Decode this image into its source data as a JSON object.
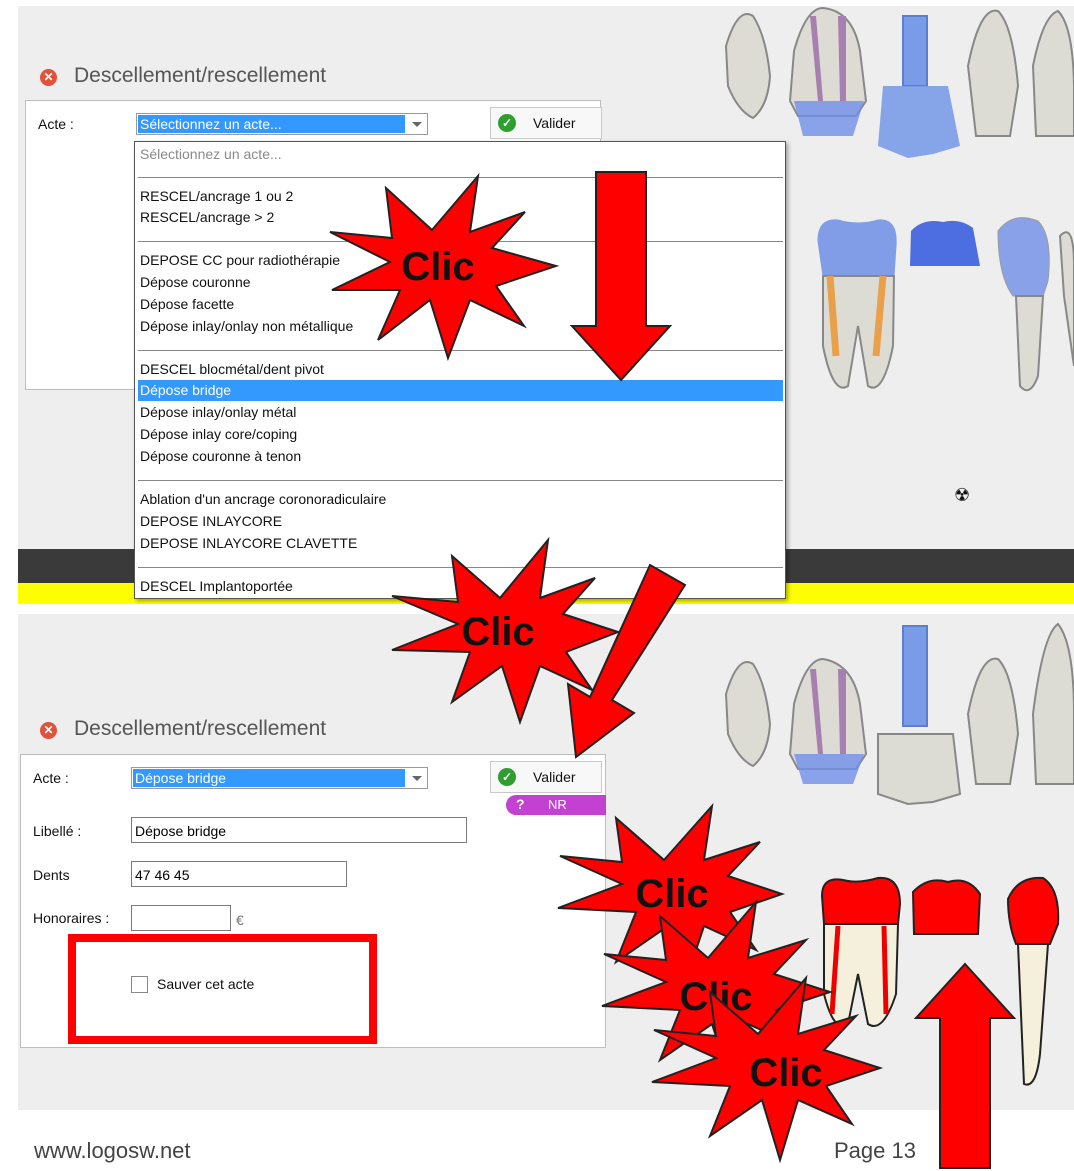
{
  "top_dialog": {
    "title": "Descellement/rescellement",
    "acte_label": "Acte :",
    "acte_value": "Sélectionnez un acte...",
    "valider_label": "Valider",
    "dropdown": {
      "placeholder": "Sélectionnez un acte...",
      "groups": [
        [
          "RESCEL/ancrage 1 ou 2",
          "RESCEL/ancrage > 2"
        ],
        [
          "DEPOSE CC pour radiothérapie",
          "Dépose couronne",
          "Dépose facette",
          "Dépose inlay/onlay non métallique"
        ],
        [
          "DESCEL blocmétal/dent pivot",
          "Dépose bridge",
          "Dépose inlay/onlay métal",
          "Dépose inlay core/coping",
          "Dépose couronne à tenon"
        ],
        [
          "Ablation d'un ancrage coronoradiculaire",
          "DEPOSE INLAYCORE",
          "DEPOSE INLAYCORE CLAVETTE"
        ],
        [
          "DESCEL Implantoportée"
        ]
      ],
      "highlighted": "Dépose bridge"
    }
  },
  "bottom_dialog": {
    "title": "Descellement/rescellement",
    "acte_label": "Acte :",
    "acte_value": "Dépose bridge",
    "valider_label": "Valider",
    "nr_badge": "NR",
    "libelle_label": "Libellé :",
    "libelle_value": "Dépose bridge",
    "dents_label": "Dents",
    "dents_value": "47 46 45",
    "honoraires_label": "Honoraires :",
    "honoraires_value": "",
    "currency": "€",
    "save_checkbox_label": "Sauver cet acte",
    "save_checked": false
  },
  "annotations": {
    "click_text": "Clic"
  },
  "footer": {
    "website": "www.logosw.net",
    "page": "Page 13"
  },
  "colors": {
    "highlight": "#3399ff",
    "annotation_red": "#ff0000",
    "tooth_selected": "#ff0000",
    "tooth_blue": "#6f8fe8"
  }
}
